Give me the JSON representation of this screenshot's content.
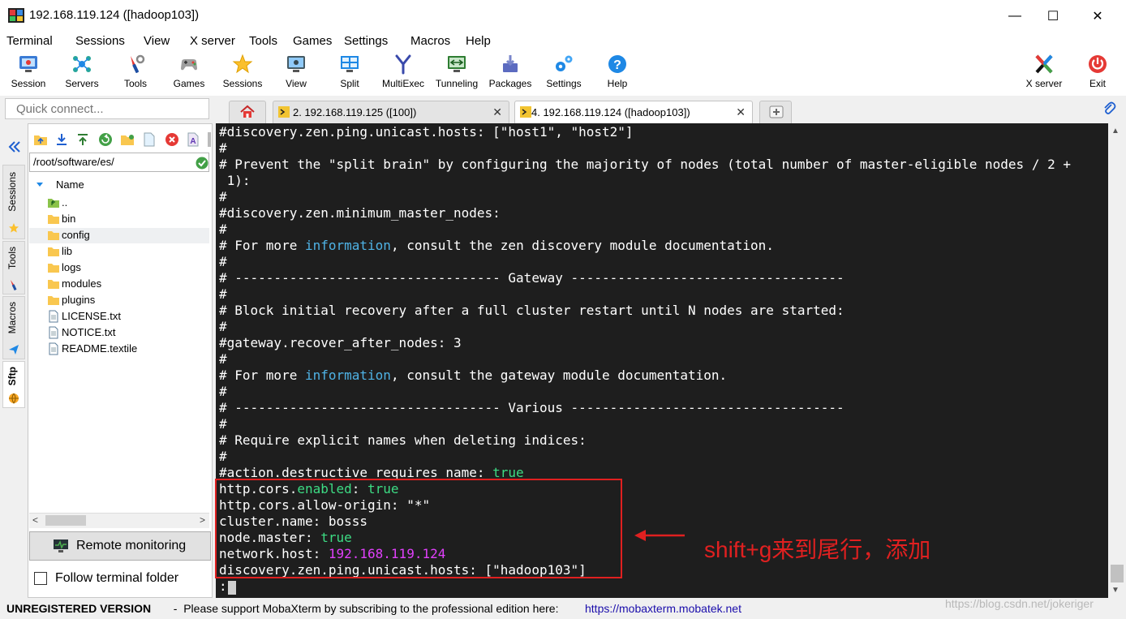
{
  "window": {
    "title": "192.168.119.124 ([hadoop103])",
    "minimize": "—",
    "maximize": "☐",
    "close": "✕"
  },
  "menu": [
    "Terminal",
    "Sessions",
    "View",
    "X server",
    "Tools",
    "Games",
    "Settings",
    "Macros",
    "Help"
  ],
  "toolbar": {
    "items": [
      {
        "label": "Session",
        "icon": "session-icon"
      },
      {
        "label": "Servers",
        "icon": "servers-icon"
      },
      {
        "label": "Tools",
        "icon": "tools-icon"
      },
      {
        "label": "Games",
        "icon": "games-icon"
      },
      {
        "label": "Sessions",
        "icon": "star-icon"
      },
      {
        "label": "View",
        "icon": "view-icon"
      },
      {
        "label": "Split",
        "icon": "split-icon"
      },
      {
        "label": "MultiExec",
        "icon": "multiexec-icon"
      },
      {
        "label": "Tunneling",
        "icon": "tunneling-icon"
      },
      {
        "label": "Packages",
        "icon": "packages-icon"
      },
      {
        "label": "Settings",
        "icon": "gears-icon"
      },
      {
        "label": "Help",
        "icon": "help-icon"
      }
    ],
    "right": [
      {
        "label": "X server",
        "icon": "x-server-icon"
      },
      {
        "label": "Exit",
        "icon": "power-icon"
      }
    ]
  },
  "quick_connect": {
    "placeholder": "Quick connect..."
  },
  "tabs": [
    {
      "label": "2. 192.168.119.125 ([100])",
      "close": "✕",
      "active": false
    },
    {
      "label": "4. 192.168.119.124 ([hadoop103])",
      "close": "✕",
      "active": true
    }
  ],
  "side_tabs": [
    "Sessions",
    "Tools",
    "Macros",
    "Sftp"
  ],
  "sftp": {
    "path": "/root/software/es/",
    "column_header": "Name",
    "files": [
      {
        "name": "..",
        "type": "parent",
        "selected": false
      },
      {
        "name": "bin",
        "type": "folder",
        "selected": false
      },
      {
        "name": "config",
        "type": "folder",
        "selected": true
      },
      {
        "name": "lib",
        "type": "folder",
        "selected": false
      },
      {
        "name": "logs",
        "type": "folder",
        "selected": false
      },
      {
        "name": "modules",
        "type": "folder",
        "selected": false
      },
      {
        "name": "plugins",
        "type": "folder",
        "selected": false
      },
      {
        "name": "LICENSE.txt",
        "type": "file",
        "selected": false
      },
      {
        "name": "NOTICE.txt",
        "type": "file",
        "selected": false
      },
      {
        "name": "README.textile",
        "type": "file",
        "selected": false
      }
    ],
    "remote_monitoring": "Remote monitoring",
    "follow_terminal": "Follow terminal folder"
  },
  "terminal": {
    "lines": [
      [
        {
          "t": "#discovery.zen.ping.unicast.hosts: [\"host1\", \"host2\"]",
          "c": "w"
        }
      ],
      [
        {
          "t": "#",
          "c": "w"
        }
      ],
      [
        {
          "t": "# Prevent the \"split brain\" by configuring the majority of nodes (total number of master-eligible nodes / 2 +",
          "c": "w"
        }
      ],
      [
        {
          "t": " 1):",
          "c": "w"
        }
      ],
      [
        {
          "t": "#",
          "c": "w"
        }
      ],
      [
        {
          "t": "#discovery.zen.minimum_master_nodes:",
          "c": "w"
        }
      ],
      [
        {
          "t": "#",
          "c": "w"
        }
      ],
      [
        {
          "t": "# For more ",
          "c": "w"
        },
        {
          "t": "information",
          "c": "b"
        },
        {
          "t": ", consult the zen discovery module documentation.",
          "c": "w"
        }
      ],
      [
        {
          "t": "#",
          "c": "w"
        }
      ],
      [
        {
          "t": "# ---------------------------------- Gateway -----------------------------------",
          "c": "w"
        }
      ],
      [
        {
          "t": "#",
          "c": "w"
        }
      ],
      [
        {
          "t": "# Block initial recovery after a full cluster restart until N nodes are started:",
          "c": "w"
        }
      ],
      [
        {
          "t": "#",
          "c": "w"
        }
      ],
      [
        {
          "t": "#gateway.recover_after_nodes: 3",
          "c": "w"
        }
      ],
      [
        {
          "t": "#",
          "c": "w"
        }
      ],
      [
        {
          "t": "# For more ",
          "c": "w"
        },
        {
          "t": "information",
          "c": "b"
        },
        {
          "t": ", consult the gateway module documentation.",
          "c": "w"
        }
      ],
      [
        {
          "t": "#",
          "c": "w"
        }
      ],
      [
        {
          "t": "# ---------------------------------- Various -----------------------------------",
          "c": "w"
        }
      ],
      [
        {
          "t": "#",
          "c": "w"
        }
      ],
      [
        {
          "t": "# Require explicit names when deleting indices:",
          "c": "w"
        }
      ],
      [
        {
          "t": "#",
          "c": "w"
        }
      ],
      [
        {
          "t": "#action.destructive_requires_name: ",
          "c": "w"
        },
        {
          "t": "true",
          "c": "g"
        }
      ],
      [
        {
          "t": "http.cors.",
          "c": "w"
        },
        {
          "t": "enabled",
          "c": "g"
        },
        {
          "t": ": ",
          "c": "w"
        },
        {
          "t": "true",
          "c": "g"
        }
      ],
      [
        {
          "t": "http.cors.allow-origin: \"*\"",
          "c": "w"
        }
      ],
      [
        {
          "t": "cluster.name: bosss",
          "c": "w"
        }
      ],
      [
        {
          "t": "node.master: ",
          "c": "w"
        },
        {
          "t": "true",
          "c": "g"
        }
      ],
      [
        {
          "t": "network.host: ",
          "c": "w"
        },
        {
          "t": "192.168.119.124",
          "c": "m"
        }
      ],
      [
        {
          "t": "discovery.zen.ping.unicast.hosts: [\"hadoop103\"]",
          "c": "w"
        }
      ],
      [
        {
          "t": ":",
          "c": "w"
        }
      ]
    ],
    "colors": {
      "w": "#ffffff",
      "b": "#4fb3e6",
      "g": "#3ddc84",
      "m": "#e040fb"
    }
  },
  "annotation": {
    "text": "shift+g来到尾行，添加",
    "color": "#e02020"
  },
  "status": {
    "unregistered": "UNREGISTERED VERSION",
    "message": "  -  Please support MobaXterm by subscribing to the professional edition here:",
    "link": "https://mobaxterm.mobatek.net",
    "watermark": "https://blog.csdn.net/jokeriger"
  }
}
